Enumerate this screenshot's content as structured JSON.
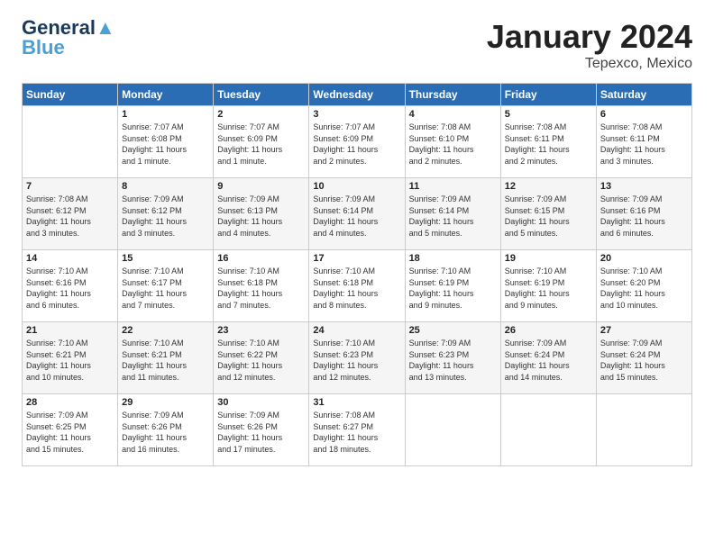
{
  "logo": {
    "line1": "General",
    "line2": "Blue"
  },
  "title": "January 2024",
  "location": "Tepexco, Mexico",
  "days_of_week": [
    "Sunday",
    "Monday",
    "Tuesday",
    "Wednesday",
    "Thursday",
    "Friday",
    "Saturday"
  ],
  "weeks": [
    [
      {
        "day": "",
        "info": ""
      },
      {
        "day": "1",
        "info": "Sunrise: 7:07 AM\nSunset: 6:08 PM\nDaylight: 11 hours\nand 1 minute."
      },
      {
        "day": "2",
        "info": "Sunrise: 7:07 AM\nSunset: 6:09 PM\nDaylight: 11 hours\nand 1 minute."
      },
      {
        "day": "3",
        "info": "Sunrise: 7:07 AM\nSunset: 6:09 PM\nDaylight: 11 hours\nand 2 minutes."
      },
      {
        "day": "4",
        "info": "Sunrise: 7:08 AM\nSunset: 6:10 PM\nDaylight: 11 hours\nand 2 minutes."
      },
      {
        "day": "5",
        "info": "Sunrise: 7:08 AM\nSunset: 6:11 PM\nDaylight: 11 hours\nand 2 minutes."
      },
      {
        "day": "6",
        "info": "Sunrise: 7:08 AM\nSunset: 6:11 PM\nDaylight: 11 hours\nand 3 minutes."
      }
    ],
    [
      {
        "day": "7",
        "info": "Sunrise: 7:08 AM\nSunset: 6:12 PM\nDaylight: 11 hours\nand 3 minutes."
      },
      {
        "day": "8",
        "info": "Sunrise: 7:09 AM\nSunset: 6:12 PM\nDaylight: 11 hours\nand 3 minutes."
      },
      {
        "day": "9",
        "info": "Sunrise: 7:09 AM\nSunset: 6:13 PM\nDaylight: 11 hours\nand 4 minutes."
      },
      {
        "day": "10",
        "info": "Sunrise: 7:09 AM\nSunset: 6:14 PM\nDaylight: 11 hours\nand 4 minutes."
      },
      {
        "day": "11",
        "info": "Sunrise: 7:09 AM\nSunset: 6:14 PM\nDaylight: 11 hours\nand 5 minutes."
      },
      {
        "day": "12",
        "info": "Sunrise: 7:09 AM\nSunset: 6:15 PM\nDaylight: 11 hours\nand 5 minutes."
      },
      {
        "day": "13",
        "info": "Sunrise: 7:09 AM\nSunset: 6:16 PM\nDaylight: 11 hours\nand 6 minutes."
      }
    ],
    [
      {
        "day": "14",
        "info": "Sunrise: 7:10 AM\nSunset: 6:16 PM\nDaylight: 11 hours\nand 6 minutes."
      },
      {
        "day": "15",
        "info": "Sunrise: 7:10 AM\nSunset: 6:17 PM\nDaylight: 11 hours\nand 7 minutes."
      },
      {
        "day": "16",
        "info": "Sunrise: 7:10 AM\nSunset: 6:18 PM\nDaylight: 11 hours\nand 7 minutes."
      },
      {
        "day": "17",
        "info": "Sunrise: 7:10 AM\nSunset: 6:18 PM\nDaylight: 11 hours\nand 8 minutes."
      },
      {
        "day": "18",
        "info": "Sunrise: 7:10 AM\nSunset: 6:19 PM\nDaylight: 11 hours\nand 9 minutes."
      },
      {
        "day": "19",
        "info": "Sunrise: 7:10 AM\nSunset: 6:19 PM\nDaylight: 11 hours\nand 9 minutes."
      },
      {
        "day": "20",
        "info": "Sunrise: 7:10 AM\nSunset: 6:20 PM\nDaylight: 11 hours\nand 10 minutes."
      }
    ],
    [
      {
        "day": "21",
        "info": "Sunrise: 7:10 AM\nSunset: 6:21 PM\nDaylight: 11 hours\nand 10 minutes."
      },
      {
        "day": "22",
        "info": "Sunrise: 7:10 AM\nSunset: 6:21 PM\nDaylight: 11 hours\nand 11 minutes."
      },
      {
        "day": "23",
        "info": "Sunrise: 7:10 AM\nSunset: 6:22 PM\nDaylight: 11 hours\nand 12 minutes."
      },
      {
        "day": "24",
        "info": "Sunrise: 7:10 AM\nSunset: 6:23 PM\nDaylight: 11 hours\nand 12 minutes."
      },
      {
        "day": "25",
        "info": "Sunrise: 7:09 AM\nSunset: 6:23 PM\nDaylight: 11 hours\nand 13 minutes."
      },
      {
        "day": "26",
        "info": "Sunrise: 7:09 AM\nSunset: 6:24 PM\nDaylight: 11 hours\nand 14 minutes."
      },
      {
        "day": "27",
        "info": "Sunrise: 7:09 AM\nSunset: 6:24 PM\nDaylight: 11 hours\nand 15 minutes."
      }
    ],
    [
      {
        "day": "28",
        "info": "Sunrise: 7:09 AM\nSunset: 6:25 PM\nDaylight: 11 hours\nand 15 minutes."
      },
      {
        "day": "29",
        "info": "Sunrise: 7:09 AM\nSunset: 6:26 PM\nDaylight: 11 hours\nand 16 minutes."
      },
      {
        "day": "30",
        "info": "Sunrise: 7:09 AM\nSunset: 6:26 PM\nDaylight: 11 hours\nand 17 minutes."
      },
      {
        "day": "31",
        "info": "Sunrise: 7:08 AM\nSunset: 6:27 PM\nDaylight: 11 hours\nand 18 minutes."
      },
      {
        "day": "",
        "info": ""
      },
      {
        "day": "",
        "info": ""
      },
      {
        "day": "",
        "info": ""
      }
    ]
  ]
}
